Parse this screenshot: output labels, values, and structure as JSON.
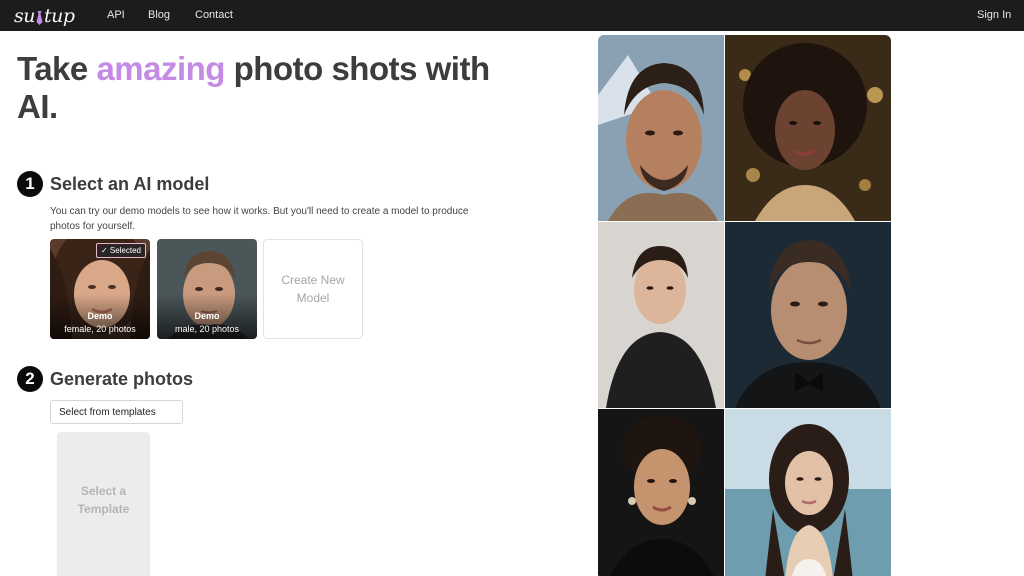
{
  "nav": {
    "logo_text_left": "su",
    "logo_text_right": "tup",
    "links": [
      "API",
      "Blog",
      "Contact"
    ],
    "sign_in": "Sign In"
  },
  "hero": {
    "title_before": "Take ",
    "title_accent": "amazing",
    "title_after": " photo shots with AI."
  },
  "step1": {
    "number": "1",
    "title": "Select an AI model",
    "description": "You can try our demo models to see how it works. But you'll need to create a model to produce photos for yourself.",
    "models": [
      {
        "name": "Demo",
        "meta": "female, 20 photos",
        "badge": "✓ Selected"
      },
      {
        "name": "Demo",
        "meta": "male, 20 photos"
      }
    ],
    "create_label": "Create New Model"
  },
  "step2": {
    "number": "2",
    "title": "Generate photos",
    "select_label": "Select from templates",
    "placeholder": "Select a Template"
  },
  "colors": {
    "nav_bg": "#1c1c1c",
    "accent": "#c58ae6",
    "step_circle": "#0b0b0b"
  }
}
